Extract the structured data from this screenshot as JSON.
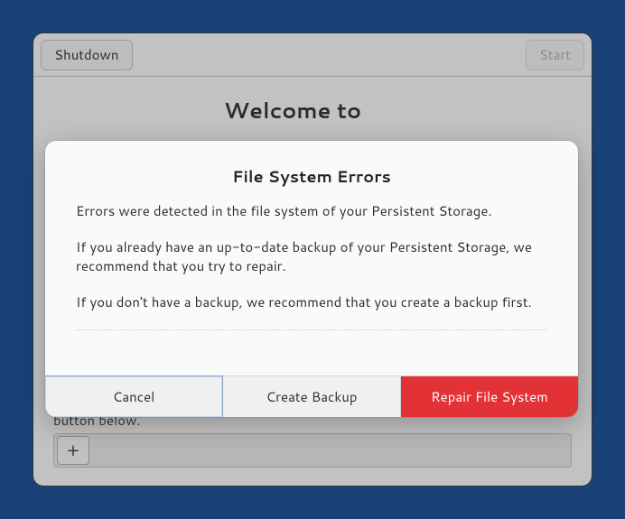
{
  "header": {
    "shutdown_label": "Shutdown",
    "start_label": "Start"
  },
  "main": {
    "welcome_title": "Welcome to",
    "hint_text": "button below.",
    "plus_icon": "+"
  },
  "modal": {
    "title": "File System Errors",
    "p1": "Errors were detected in the file system of your Persistent Storage.",
    "p2": "If you already have an up-to-date backup of your Persistent Storage, we recommend that you try to repair.",
    "p3": "If you don't have a backup, we recommend that you create a backup first.",
    "cancel_label": "Cancel",
    "backup_label": "Create Backup",
    "repair_label": "Repair File System"
  }
}
